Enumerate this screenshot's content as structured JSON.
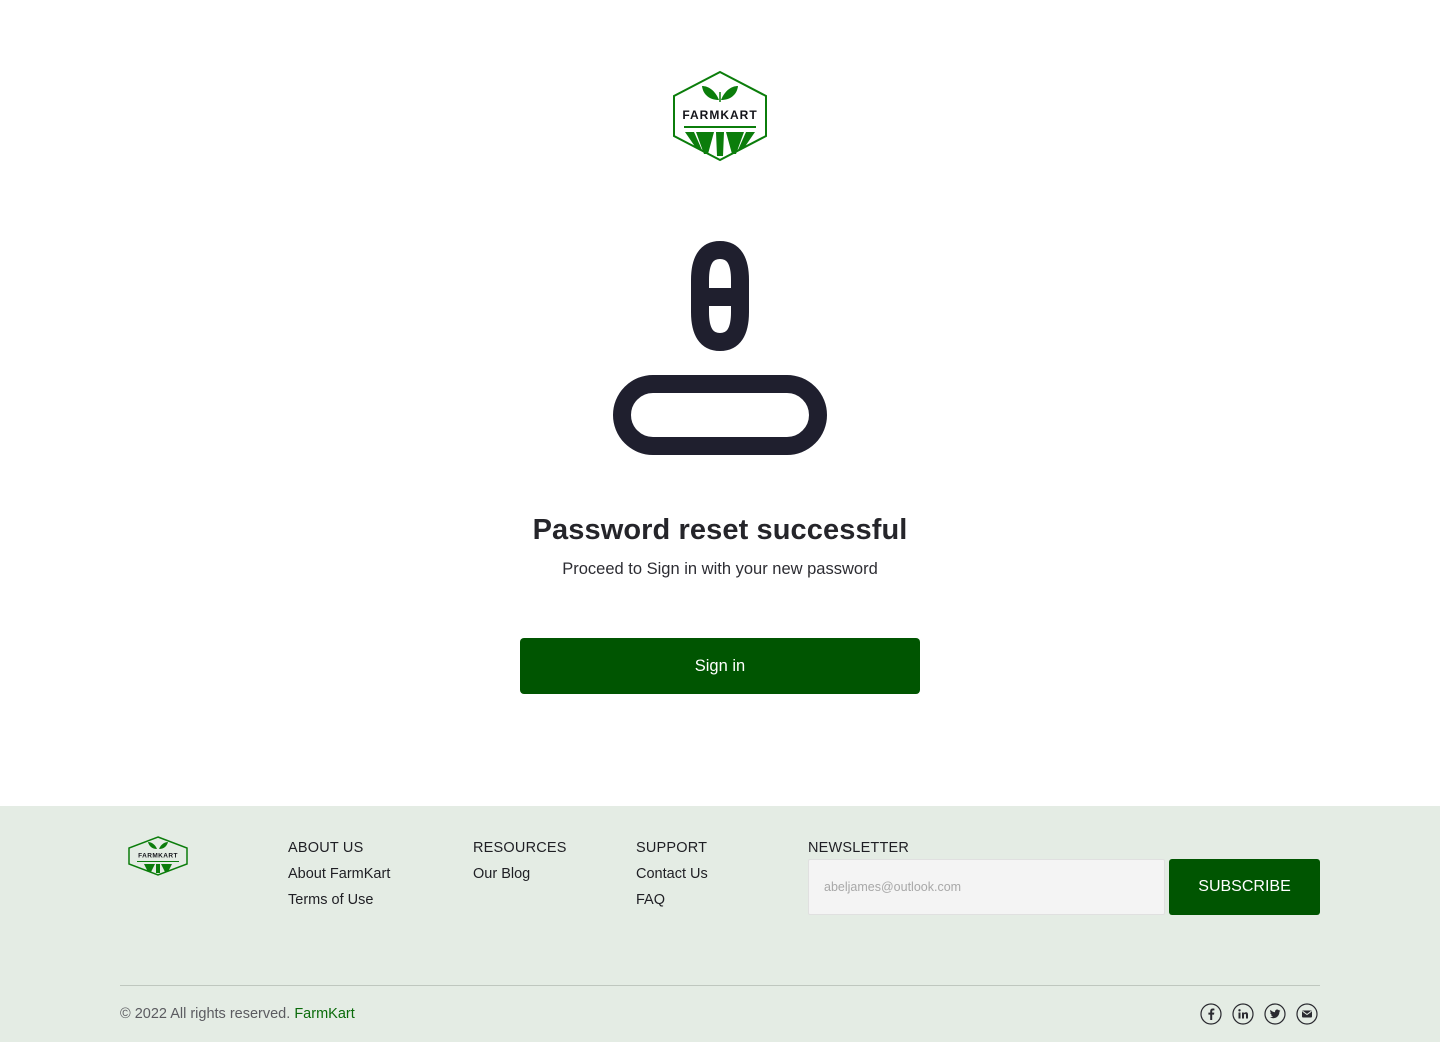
{
  "brand": {
    "logo_text": "FARMKART"
  },
  "main": {
    "title": "Password reset successful",
    "subtitle": "Proceed to Sign in with your new password",
    "signin_label": "Sign in"
  },
  "footer": {
    "columns": [
      {
        "heading": "ABOUT US",
        "links": [
          "About FarmKart",
          "Terms of Use"
        ]
      },
      {
        "heading": "RESOURCES",
        "links": [
          "Our Blog"
        ]
      },
      {
        "heading": "SUPPORT",
        "links": [
          "Contact Us",
          "FAQ"
        ]
      }
    ],
    "newsletter": {
      "heading": "NEWSLETTER",
      "placeholder": "abeljames@outlook.com",
      "button": "SUBSCRIBE"
    },
    "copyright": "© 2022 All rights reserved.",
    "copyright_brand": "FarmKart",
    "social_icons": [
      "facebook-icon",
      "linkedin-icon",
      "twitter-icon",
      "email-icon"
    ]
  },
  "colors": {
    "primary": "#005501",
    "footer_bg": "#e4ece4",
    "logo_green": "#0b7d0b",
    "icon_dark": "#1f1f2e"
  }
}
